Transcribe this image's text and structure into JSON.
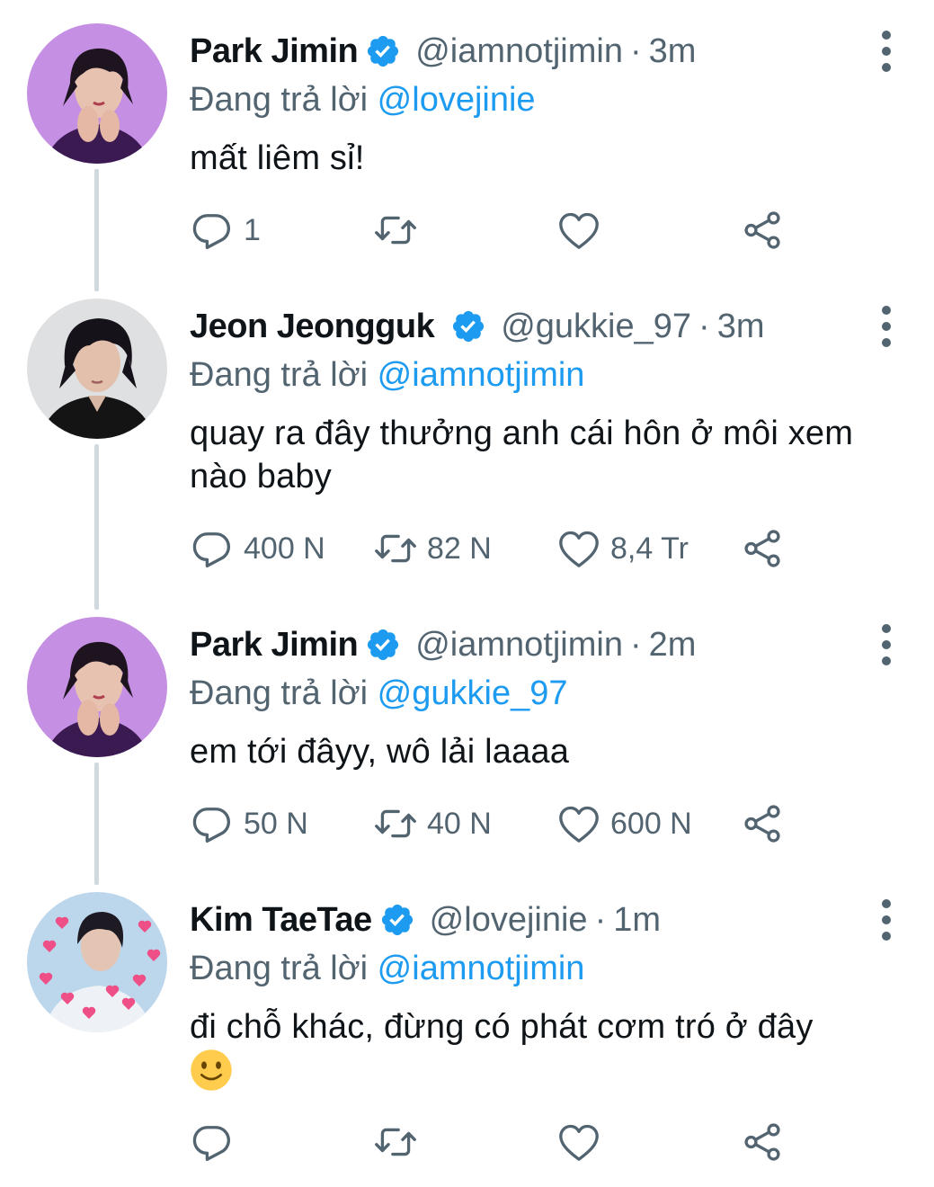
{
  "colors": {
    "text": "#0f1419",
    "secondary": "#536471",
    "accent": "#1d9bf0",
    "thread_line": "#cfd9de"
  },
  "icons": {
    "reply": "speech-bubble-icon",
    "retweet": "retweet-arrows-icon",
    "like": "heart-icon",
    "share": "share-nodes-icon",
    "verified": "verified-badge-icon",
    "more": "vertical-dots-icon"
  },
  "tweets": [
    {
      "name": "Park Jimin",
      "handle": "@iamnotjimin",
      "separator": "·",
      "time": "3m",
      "reply_prefix": "Đang trả lời",
      "reply_to": "@lovejinie",
      "text": "mất liêm sỉ!",
      "counts": {
        "reply": "1",
        "retweet": "",
        "like": ""
      }
    },
    {
      "name": "Jeon Jeongguk",
      "handle": "@gukkie_97",
      "separator": "·",
      "time": "3m",
      "reply_prefix": "Đang trả lời",
      "reply_to": "@iamnotjimin",
      "text_line1": "quay ra đây thưởng anh cái hôn ở môi xem",
      "text_line2": "nào baby",
      "counts": {
        "reply": "400 N",
        "retweet": "82 N",
        "like": "8,4 Tr"
      }
    },
    {
      "name": "Park Jimin",
      "handle": "@iamnotjimin",
      "separator": "·",
      "time": "2m",
      "reply_prefix": "Đang trả lời",
      "reply_to": "@gukkie_97",
      "text": "em tới đâyy, wô lải laaaa",
      "counts": {
        "reply": "50 N",
        "retweet": "40 N",
        "like": "600 N"
      }
    },
    {
      "name": "Kim TaeTae",
      "handle": "@lovejinie",
      "separator": "·",
      "time": "1m",
      "reply_prefix": "Đang trả lời",
      "reply_to": "@iamnotjimin",
      "text": "đi chỗ khác, đừng có phát cơm tró ở đây",
      "emoji": "slightly-smiling-face-icon",
      "counts": {
        "reply": "",
        "retweet": "",
        "like": ""
      }
    }
  ]
}
